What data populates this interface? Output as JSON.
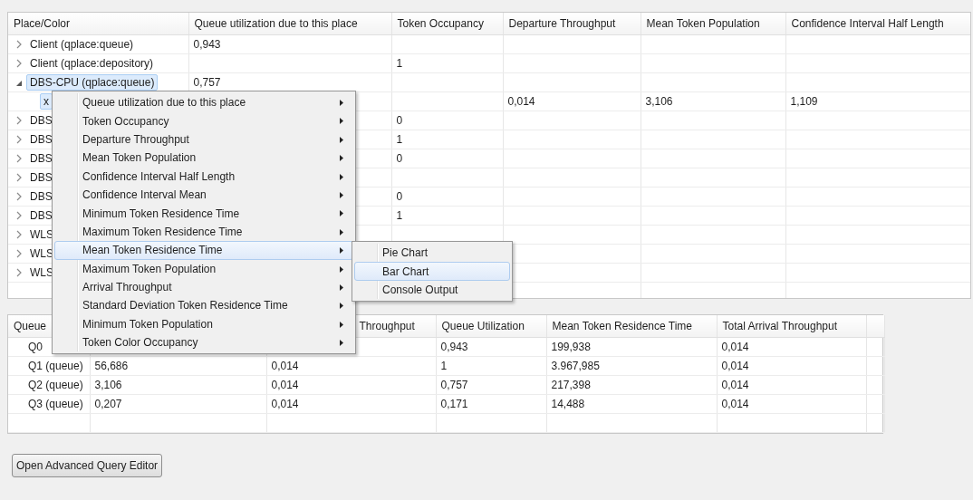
{
  "tree_table": {
    "columns": [
      "Place/Color",
      "Queue utilization due to this place",
      "Token Occupancy",
      "Departure Throughput",
      "Mean Token Population",
      "Confidence Interval Half Length"
    ],
    "rows": [
      {
        "expanded": false,
        "selected": false,
        "cells": [
          "Client (qplace:queue)",
          "0,943",
          null,
          null,
          null,
          null
        ]
      },
      {
        "expanded": false,
        "selected": false,
        "cells": [
          "Client (qplace:depository)",
          null,
          "1",
          null,
          null,
          null
        ]
      },
      {
        "expanded": true,
        "selected": true,
        "cells": [
          "DBS-CPU (qplace:queue)",
          "0,757",
          null,
          null,
          null,
          null
        ],
        "children": [
          {
            "selected": true,
            "cells": [
              "x",
              null,
              null,
              "0,014",
              "3,106",
              "1,109"
            ]
          }
        ]
      },
      {
        "expanded": false,
        "selected": false,
        "cells": [
          "DBS",
          null,
          "0",
          null,
          null,
          null
        ]
      },
      {
        "expanded": false,
        "selected": false,
        "cells": [
          "DBS",
          null,
          "1",
          null,
          null,
          null
        ]
      },
      {
        "expanded": false,
        "selected": false,
        "cells": [
          "DBS",
          null,
          "0",
          null,
          null,
          null
        ]
      },
      {
        "expanded": false,
        "selected": false,
        "cells": [
          "DBS",
          null,
          null,
          null,
          null,
          null
        ]
      },
      {
        "expanded": false,
        "selected": false,
        "cells": [
          "DBS",
          null,
          "0",
          null,
          null,
          null
        ]
      },
      {
        "expanded": false,
        "selected": false,
        "cells": [
          "DBS",
          null,
          "1",
          null,
          null,
          null
        ]
      },
      {
        "expanded": false,
        "selected": false,
        "cells": [
          "WLS",
          null,
          null,
          null,
          null,
          null
        ]
      },
      {
        "expanded": false,
        "selected": false,
        "cells": [
          "WLS",
          null,
          null,
          null,
          null,
          null
        ]
      },
      {
        "expanded": false,
        "selected": false,
        "cells": [
          "WLS",
          null,
          null,
          null,
          null,
          null
        ]
      }
    ]
  },
  "context_menu": {
    "items": [
      {
        "label": "Queue utilization due to this place",
        "selected": false
      },
      {
        "label": "Token Occupancy",
        "selected": false
      },
      {
        "label": "Departure Throughput",
        "selected": false
      },
      {
        "label": "Mean Token Population",
        "selected": false
      },
      {
        "label": "Confidence Interval Half Length",
        "selected": false
      },
      {
        "label": "Confidence Interval Mean",
        "selected": false
      },
      {
        "label": "Minimum Token Residence Time",
        "selected": false
      },
      {
        "label": "Maximum Token Residence Time",
        "selected": false
      },
      {
        "label": "Mean Token Residence Time",
        "selected": true
      },
      {
        "label": "Maximum Token Population",
        "selected": false
      },
      {
        "label": "Arrival Throughput",
        "selected": false
      },
      {
        "label": "Standard Deviation Token Residence Time",
        "selected": false
      },
      {
        "label": "Minimum Token Population",
        "selected": false
      },
      {
        "label": "Token Color Occupancy",
        "selected": false
      }
    ],
    "submenu": [
      {
        "label": "Pie Chart",
        "selected": false
      },
      {
        "label": "Bar Chart",
        "selected": true
      },
      {
        "label": "Console Output",
        "selected": false
      }
    ]
  },
  "queue_table": {
    "columns": [
      "Queue",
      null,
      "Throughput",
      "Queue Utilization",
      "Mean Token Residence Time",
      "Total Arrival Throughput"
    ],
    "rows": [
      {
        "cells": [
          "Q0",
          null,
          null,
          "0,943",
          "199,938",
          "0,014"
        ]
      },
      {
        "cells": [
          "Q1 (queue)",
          "56,686",
          "0,014",
          "1",
          "3.967,985",
          "0,014"
        ]
      },
      {
        "cells": [
          "Q2 (queue)",
          "3,106",
          "0,014",
          "0,757",
          "217,398",
          "0,014"
        ]
      },
      {
        "cells": [
          "Q3 (queue)",
          "0,207",
          "0,014",
          "0,171",
          "14,488",
          "0,014"
        ]
      }
    ]
  },
  "buttons": [
    "Open Advanced Query Editor"
  ]
}
